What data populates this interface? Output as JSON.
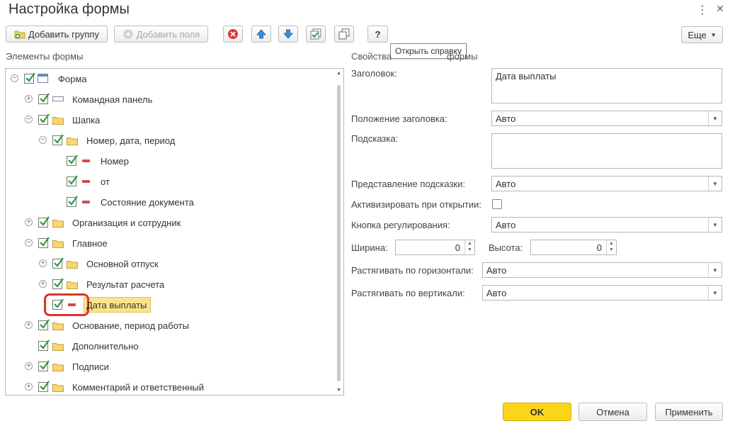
{
  "window": {
    "title": "Настройка формы",
    "more_icon": "⋮",
    "close_icon": "✕"
  },
  "toolbar": {
    "add_group": "Добавить группу",
    "add_fields": "Добавить поля",
    "more": "Еще",
    "help": "?"
  },
  "tooltip": "Открыть справку",
  "left": {
    "header": "Элементы формы"
  },
  "tree": [
    {
      "label": "Форма",
      "level": 0,
      "icon": "form-icon",
      "expander": "minus"
    },
    {
      "label": "Командная панель",
      "level": 1,
      "icon": "command-panel-icon",
      "expander": "plus"
    },
    {
      "label": "Шапка",
      "level": 1,
      "icon": "folder-icon",
      "expander": "minus"
    },
    {
      "label": "Номер, дата, период",
      "level": 2,
      "icon": "folder-icon",
      "expander": "minus"
    },
    {
      "label": "Номер",
      "level": 3,
      "icon": "field-icon",
      "expander": "none"
    },
    {
      "label": "от",
      "level": 3,
      "icon": "field-icon",
      "expander": "none"
    },
    {
      "label": "Состояние документа",
      "level": 3,
      "icon": "field-icon",
      "expander": "none"
    },
    {
      "label": "Организация и сотрудник",
      "level": 1,
      "icon": "folder-icon",
      "expander": "plus"
    },
    {
      "label": "Главное",
      "level": 1,
      "icon": "folder-icon",
      "expander": "minus"
    },
    {
      "label": "Основной отпуск",
      "level": 2,
      "icon": "folder-icon",
      "expander": "plus"
    },
    {
      "label": "Результат расчета",
      "level": 2,
      "icon": "folder-icon",
      "expander": "plus"
    },
    {
      "label": "Дата выплаты",
      "level": 2,
      "icon": "field-icon",
      "expander": "none",
      "selected": true
    },
    {
      "label": "Основание, период работы",
      "level": 1,
      "icon": "folder-icon",
      "expander": "plus"
    },
    {
      "label": "Дополнительно",
      "level": 1,
      "icon": "folder-icon",
      "expander": "none"
    },
    {
      "label": "Подписи",
      "level": 1,
      "icon": "folder-icon",
      "expander": "plus"
    },
    {
      "label": "Комментарий и ответственный",
      "level": 1,
      "icon": "folder-icon",
      "expander": "plus"
    }
  ],
  "right": {
    "header_visible": "Свойства",
    "header_tail": "формы"
  },
  "props": {
    "title_label": "Заголовок:",
    "title_value": "Дата выплаты",
    "title_pos_label": "Положение заголовка:",
    "title_pos_value": "Авто",
    "hint_label": "Подсказка:",
    "hint_value": "",
    "hint_view_label": "Представление подсказки:",
    "hint_view_value": "Авто",
    "activate_label": "Активизировать при открытии:",
    "adjust_btn_label": "Кнопка регулирования:",
    "adjust_btn_value": "Авто",
    "width_label": "Ширина:",
    "width_value": "0",
    "height_label": "Высота:",
    "height_value": "0",
    "stretch_h_label": "Растягивать по горизонтали:",
    "stretch_h_value": "Авто",
    "stretch_v_label": "Растягивать по вертикали:",
    "stretch_v_value": "Авто"
  },
  "footer": {
    "ok": "OK",
    "cancel": "Отмена",
    "apply": "Применить"
  },
  "colors": {
    "ok_button": "#fbd51b",
    "selected_row": "#fbe38d",
    "highlight_ring": "#d9342b",
    "check": "#2e9a43"
  }
}
